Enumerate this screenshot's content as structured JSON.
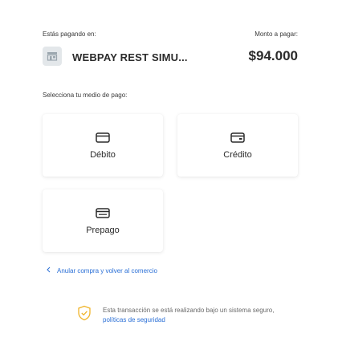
{
  "header": {
    "paying_at_label": "Estás pagando en:",
    "amount_label": "Monto a pagar:",
    "merchant_name": "WEBPAY REST SIMU...",
    "amount": "$94.000"
  },
  "payment": {
    "section_label": "Selecciona tu medio de pago:",
    "methods": [
      {
        "label": "Débito",
        "icon": "card-icon"
      },
      {
        "label": "Crédito",
        "icon": "card-chip-icon"
      },
      {
        "label": "Prepago",
        "icon": "card-stripe-icon"
      }
    ]
  },
  "footer": {
    "back_link": "Anular compra y volver al comercio",
    "secure_text": "Esta transacción se está realizando bajo un sistema seguro,",
    "secure_link": "políticas de seguridad"
  },
  "colors": {
    "link": "#2a6fd6",
    "shield": "#f0b429",
    "text": "#2b2b2b"
  }
}
